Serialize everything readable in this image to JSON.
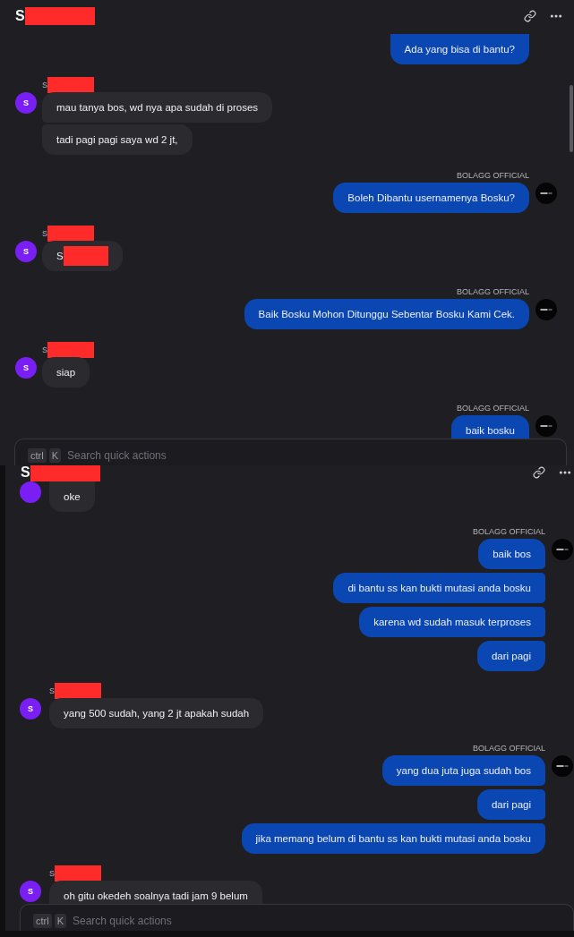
{
  "panels": [
    {
      "header": {
        "title": "S",
        "redacted": true
      },
      "messages": [
        {
          "kind": "outgoing",
          "has_avatar": false,
          "bubbles": [
            {
              "text": "Ada yang bisa di bantu?",
              "redacted": false
            }
          ]
        },
        {
          "kind": "incoming",
          "sender": {
            "name": "S",
            "redacted": true
          },
          "has_avatar": true,
          "avatar_letter": "S",
          "bubbles": [
            {
              "text": "mau tanya bos, wd nya apa sudah di proses",
              "redacted": false
            },
            {
              "text": "tadi pagi pagi saya wd 2 jt,",
              "redacted": false
            }
          ]
        },
        {
          "kind": "outgoing",
          "sender": {
            "name": "BOLAGG OFFICIAL",
            "redacted": false
          },
          "has_avatar": true,
          "bubbles": [
            {
              "text": "Boleh Dibantu usernamenya Bosku?",
              "redacted": false
            }
          ]
        },
        {
          "kind": "incoming",
          "sender": {
            "name": "S",
            "redacted": true
          },
          "has_avatar": true,
          "avatar_letter": "S",
          "bubbles": [
            {
              "text": "S",
              "redacted": true
            }
          ]
        },
        {
          "kind": "outgoing",
          "sender": {
            "name": "BOLAGG OFFICIAL",
            "redacted": false
          },
          "has_avatar": true,
          "bubbles": [
            {
              "text": "Baik Bosku Mohon Ditunggu Sebentar Bosku Kami Cek.",
              "redacted": false
            }
          ]
        },
        {
          "kind": "incoming",
          "sender": {
            "name": "S",
            "redacted": true
          },
          "has_avatar": true,
          "avatar_letter": "S",
          "bubbles": [
            {
              "text": "siap",
              "redacted": false
            }
          ]
        },
        {
          "kind": "outgoing",
          "sender": {
            "name": "BOLAGG OFFICIAL",
            "redacted": false
          },
          "has_avatar": true,
          "bubbles": [
            {
              "text": "baik bosku",
              "redacted": false
            }
          ]
        }
      ],
      "search": {
        "keys": [
          "ctrl",
          "K"
        ],
        "placeholder": "Search quick actions"
      }
    },
    {
      "header": {
        "title": "S",
        "redacted": true
      },
      "messages": [
        {
          "kind": "incoming",
          "has_avatar": true,
          "bubbles": [
            {
              "text": "oke",
              "redacted": false
            }
          ]
        },
        {
          "kind": "outgoing",
          "sender": {
            "name": "BOLAGG OFFICIAL",
            "redacted": false
          },
          "has_avatar": true,
          "bubbles": [
            {
              "text": "baik bos",
              "redacted": false
            },
            {
              "text": "di bantu ss kan bukti mutasi anda bosku",
              "redacted": false
            },
            {
              "text": "karena wd sudah masuk terproses",
              "redacted": false
            },
            {
              "text": "dari pagi",
              "redacted": false
            }
          ]
        },
        {
          "kind": "incoming",
          "sender": {
            "name": "S",
            "redacted": true
          },
          "has_avatar": true,
          "avatar_letter": "S",
          "bubbles": [
            {
              "text": "yang 500 sudah, yang 2 jt apakah sudah",
              "redacted": false
            }
          ]
        },
        {
          "kind": "outgoing",
          "sender": {
            "name": "BOLAGG OFFICIAL",
            "redacted": false
          },
          "has_avatar": true,
          "bubbles": [
            {
              "text": "yang dua juta juga sudah bos",
              "redacted": false
            },
            {
              "text": "dari pagi",
              "redacted": false
            },
            {
              "text": "jika memang belum di bantu ss kan bukti mutasi anda bosku",
              "redacted": false
            }
          ]
        },
        {
          "kind": "incoming",
          "sender": {
            "name": "S",
            "redacted": true
          },
          "has_avatar": true,
          "avatar_letter": "S",
          "bubbles": [
            {
              "text": "oh gitu okedeh soalnya tadi jam 9 belum",
              "redacted": false
            }
          ]
        }
      ],
      "search": {
        "keys": [
          "ctrl",
          "K"
        ],
        "placeholder": "Search quick actions"
      }
    }
  ]
}
